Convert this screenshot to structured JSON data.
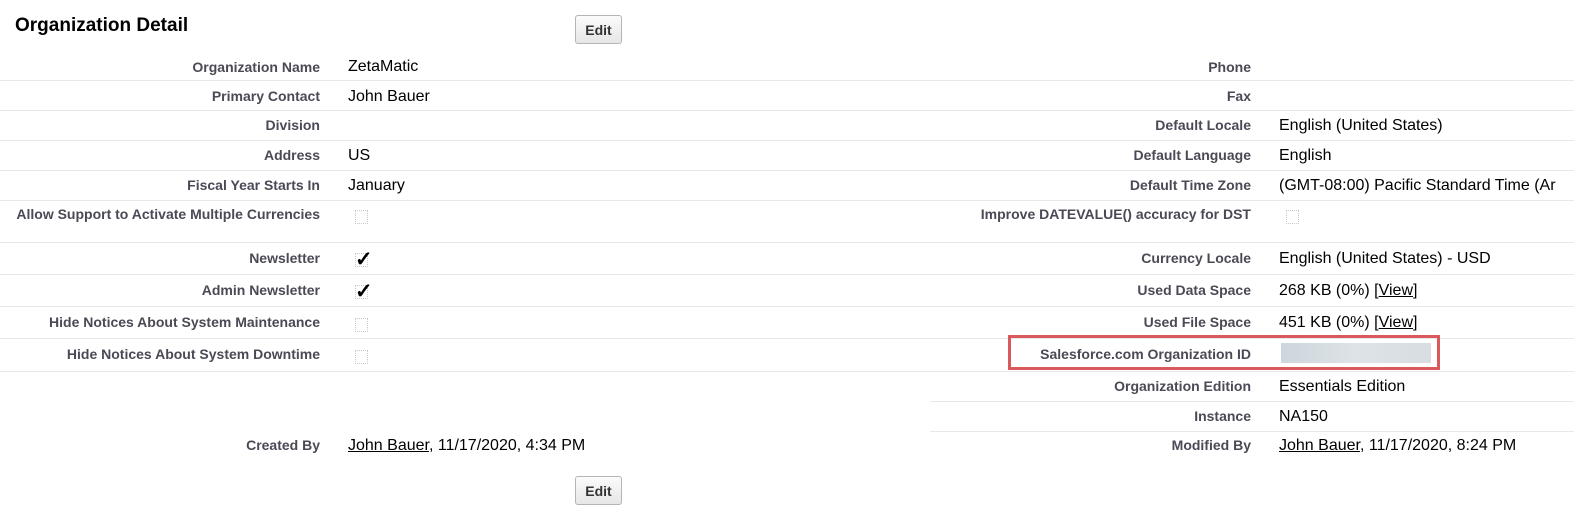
{
  "page": {
    "title": "Organization Detail",
    "edit_label": "Edit"
  },
  "left": [
    {
      "label": "Organization Name",
      "value": "ZetaMatic"
    },
    {
      "label": "Primary Contact",
      "value": "John Bauer"
    },
    {
      "label": "Division",
      "value": ""
    },
    {
      "label": "Address",
      "value": "US"
    },
    {
      "label": "Fiscal Year Starts In",
      "value": "January"
    },
    {
      "label": "Allow Support to Activate Multiple Currencies",
      "checked": false
    },
    {
      "label": "Newsletter",
      "checked": true
    },
    {
      "label": "Admin Newsletter",
      "checked": true
    },
    {
      "label": "Hide Notices About System Maintenance",
      "checked": false
    },
    {
      "label": "Hide Notices About System Downtime",
      "checked": false
    }
  ],
  "right": [
    {
      "label": "Phone",
      "value": ""
    },
    {
      "label": "Fax",
      "value": ""
    },
    {
      "label": "Default Locale",
      "value": "English (United States)"
    },
    {
      "label": "Default Language",
      "value": "English"
    },
    {
      "label": "Default Time Zone",
      "value": "(GMT-08:00) Pacific Standard Time (Ar"
    },
    {
      "label": "Improve DATEVALUE() accuracy for DST",
      "checked": false
    },
    {
      "label": "Currency Locale",
      "value": "English (United States) - USD"
    },
    {
      "label": "Used Data Space",
      "value": "268 KB (0%) [",
      "link": "View",
      "suffix": "]"
    },
    {
      "label": "Used File Space",
      "value": "451 KB (0%) [",
      "link": "View",
      "suffix": "]"
    },
    {
      "label": "Salesforce.com Organization ID",
      "value": "",
      "redacted": true
    },
    {
      "label": "Organization Edition",
      "value": "Essentials Edition"
    },
    {
      "label": "Instance",
      "value": "NA150"
    }
  ],
  "created": {
    "label": "Created By",
    "user": "John Bauer",
    "when": ", 11/17/2020, 4:34 PM"
  },
  "modified": {
    "label": "Modified By",
    "user": "John Bauer",
    "when": ", 11/17/2020, 8:24 PM"
  },
  "colors": {
    "highlight": "#d9595d"
  }
}
